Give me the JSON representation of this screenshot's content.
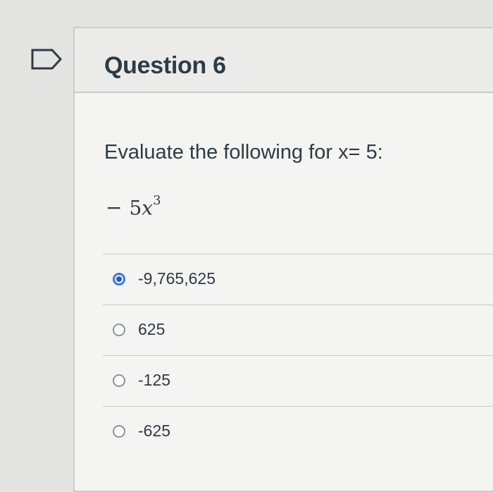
{
  "question": {
    "title": "Question 6",
    "prompt": "Evaluate the following for x= 5:",
    "expression": {
      "sign": "−",
      "coefficient": "5",
      "variable": "x",
      "exponent": "3"
    }
  },
  "answers": [
    {
      "label": "-9,765,625",
      "selected": true
    },
    {
      "label": "625",
      "selected": false
    },
    {
      "label": "-125",
      "selected": false
    },
    {
      "label": "-625",
      "selected": false
    }
  ],
  "colors": {
    "accent": "#1f5bd6",
    "text": "#2d3b45",
    "background": "#e4e4e2"
  },
  "icons": {
    "flag": "flag-icon"
  }
}
